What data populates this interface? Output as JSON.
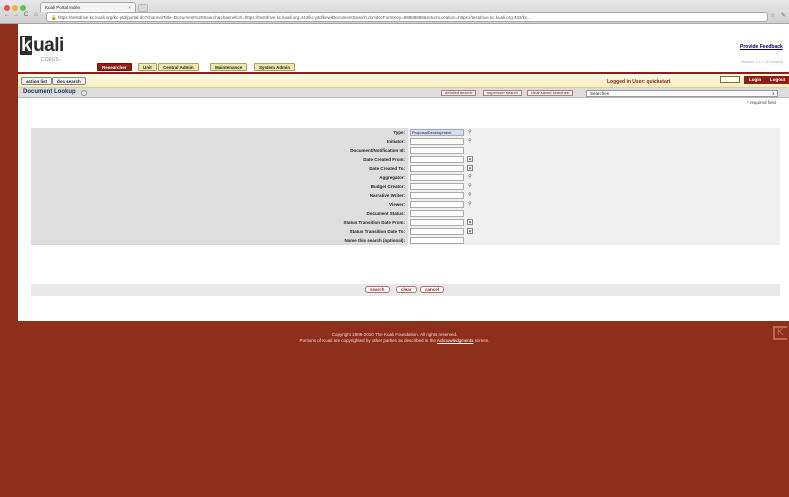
{
  "browser": {
    "tab_title": "Kuali Portal Index",
    "close_glyph": "×",
    "back": "←",
    "forward": "→",
    "reload": "C",
    "home": "⌂",
    "lock": "🔒",
    "url": "https://testdrive.kc.kuali.org/kc-ptd/portal.do?channelTitle=Document%20Search&channelUrl=https://testdrive.kc.kuali.org:443/kc-ptd/kew/DocumentSearch.do?docFormKey=88888888&returnLocation=https://testdrive.kc.kuali.org:443/kc...",
    "star": "☆",
    "wrench": "✎",
    "traffic_lights": [
      "#e0564c",
      "#e6b43b",
      "#61c454"
    ]
  },
  "header": {
    "logo_k": "k",
    "logo_rest": "uali",
    "subtitle": "COEUS ·",
    "feedback_link": "Provide Feedback",
    "version": "Version 3.1.1 (Oracle9i)"
  },
  "main_tabs": [
    {
      "label": "Researcher",
      "active": true
    },
    {
      "label": "Unit",
      "active": false
    },
    {
      "label": "Central Admin",
      "active": false
    },
    {
      "label": "Maintenance",
      "active": false
    },
    {
      "label": "System Admin",
      "active": false
    }
  ],
  "toolbar": {
    "action_list": "action list",
    "doc_search": "doc search",
    "logged_in": "Logged in User: quickstart",
    "login": "Login",
    "logout": "Logout"
  },
  "lookup": {
    "title": "Document Lookup",
    "help": "?",
    "detailed_search": "detailed search",
    "superuser_search": "superuser search",
    "clear_saved": "clear saved searches",
    "searches_select": "Searches",
    "select_arrow": "⇕",
    "required_note": "* required field"
  },
  "form": {
    "fields": [
      {
        "label": "Type:",
        "value": "ProposalDevelopment",
        "icon": "lookup",
        "selected": true
      },
      {
        "label": "Initiator:",
        "value": "",
        "icon": "lookup"
      },
      {
        "label": "Document/Notification Id:",
        "value": "",
        "icon": ""
      },
      {
        "label": "Date Created From:",
        "value": "",
        "icon": "calendar"
      },
      {
        "label": "Date Created To:",
        "value": "",
        "icon": "calendar"
      },
      {
        "label": "Aggregator:",
        "value": "",
        "icon": "lookup"
      },
      {
        "label": "Budget Creator:",
        "value": "",
        "icon": "lookup"
      },
      {
        "label": "Narrative Writer:",
        "value": "",
        "icon": "lookup"
      },
      {
        "label": "Viewer:",
        "value": "",
        "icon": "lookup"
      },
      {
        "label": "Document Status:",
        "value": "",
        "icon": ""
      },
      {
        "label": "Status Transition Date From:",
        "value": "",
        "icon": "calendar"
      },
      {
        "label": "Status Transition Date To:",
        "value": "",
        "icon": "calendar"
      },
      {
        "label": "Name this search (optional):",
        "value": "",
        "icon": ""
      }
    ],
    "lookup_glyph": "⚲",
    "calendar_glyph": "▦",
    "search_button": "search",
    "clear_button": "clear",
    "cancel_button": "cancel"
  },
  "footer": {
    "copyright": "Copyright 2005-2010 The Kuali Foundation. All rights reserved.",
    "portions_pre": "Portions of Kuali are copyrighted by other parties as described in the",
    "ack_link": "Acknowledgments",
    "portions_post": "screen.",
    "k_mark": "K"
  }
}
